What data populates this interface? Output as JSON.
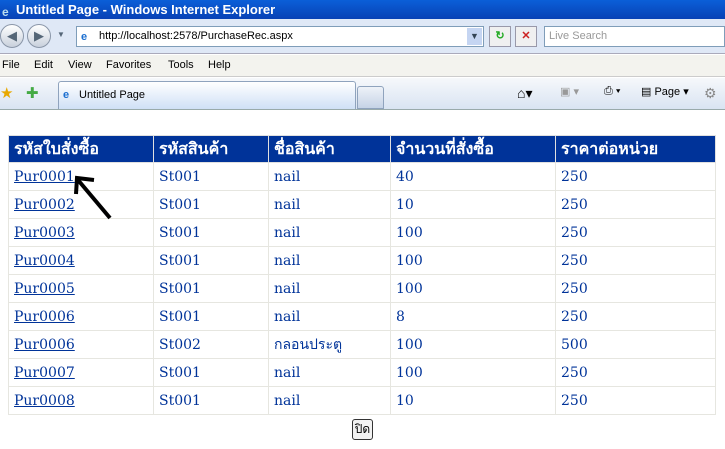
{
  "window": {
    "title": "Untitled Page - Windows Internet Explorer"
  },
  "address": {
    "url": "http://localhost:2578/PurchaseRec.aspx",
    "search_placeholder": "Live Search"
  },
  "menu": [
    "File",
    "Edit",
    "View",
    "Favorites",
    "Tools",
    "Help"
  ],
  "tab": {
    "label": "Untitled Page"
  },
  "toolbar": {
    "page_label": "Page"
  },
  "table": {
    "headers": [
      "รหัสใบสั่งซื้อ",
      "รหัสสินค้า",
      "ชื่อสินค้า",
      "จำนวนที่สั่งซื้อ",
      "ราคาต่อหน่วย"
    ],
    "rows": [
      [
        "Pur0001",
        "St001",
        "nail",
        "40",
        "250"
      ],
      [
        "Pur0002",
        "St001",
        "nail",
        "10",
        "250"
      ],
      [
        "Pur0003",
        "St001",
        "nail",
        "100",
        "250"
      ],
      [
        "Pur0004",
        "St001",
        "nail",
        "100",
        "250"
      ],
      [
        "Pur0005",
        "St001",
        "nail",
        "100",
        "250"
      ],
      [
        "Pur0006",
        "St001",
        "nail",
        "8",
        "250"
      ],
      [
        "Pur0006",
        "St002",
        "กลอนประตู",
        "100",
        "500"
      ],
      [
        "Pur0007",
        "St001",
        "nail",
        "100",
        "250"
      ],
      [
        "Pur0008",
        "St001",
        "nail",
        "10",
        "250"
      ]
    ]
  },
  "close_button": "ปิด"
}
